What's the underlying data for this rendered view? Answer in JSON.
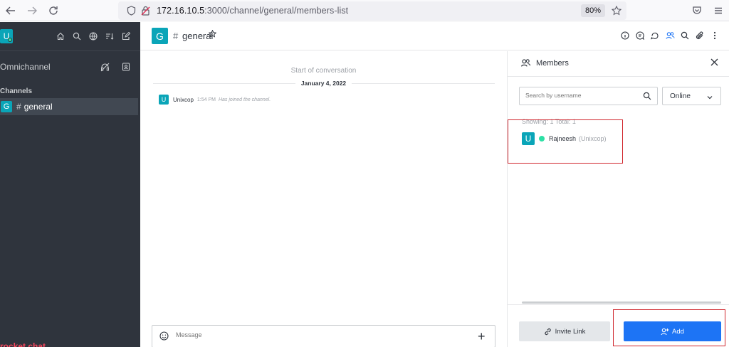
{
  "browser": {
    "url_host": "172.16.10.5",
    "url_path": ":3000/channel/general/members-list",
    "zoom": "80%"
  },
  "sidebar": {
    "user_initial": "U",
    "omnichannel_label": "Omnichannel",
    "section_title": "Channels",
    "channels": [
      {
        "initial": "G",
        "name": "general"
      }
    ],
    "logo_text": "rocket.chat"
  },
  "room": {
    "initial": "G",
    "name": "general"
  },
  "messages": {
    "start_text": "Start of conversation",
    "date": "January 4, 2022",
    "items": [
      {
        "initial": "U",
        "user": "Unixcop",
        "time": "1:54 PM",
        "text": "Has joined the channel."
      }
    ],
    "composer_placeholder": "Message"
  },
  "members_panel": {
    "title": "Members",
    "search_placeholder": "Search by username",
    "filter_value": "Online",
    "count_text": "Showing: 1 Total: 1",
    "members": [
      {
        "initial": "U",
        "name": "Rajneesh",
        "username": "(Unixcop)",
        "status": "online"
      }
    ],
    "invite_label": "Invite Link",
    "add_label": "Add"
  },
  "colors": {
    "sidebar_bg": "#2f343d",
    "accent_blue": "#1d74f5",
    "avatar_teal": "#0aa5b8",
    "online_green": "#2de0a5",
    "highlight_red": "#d0262d"
  }
}
